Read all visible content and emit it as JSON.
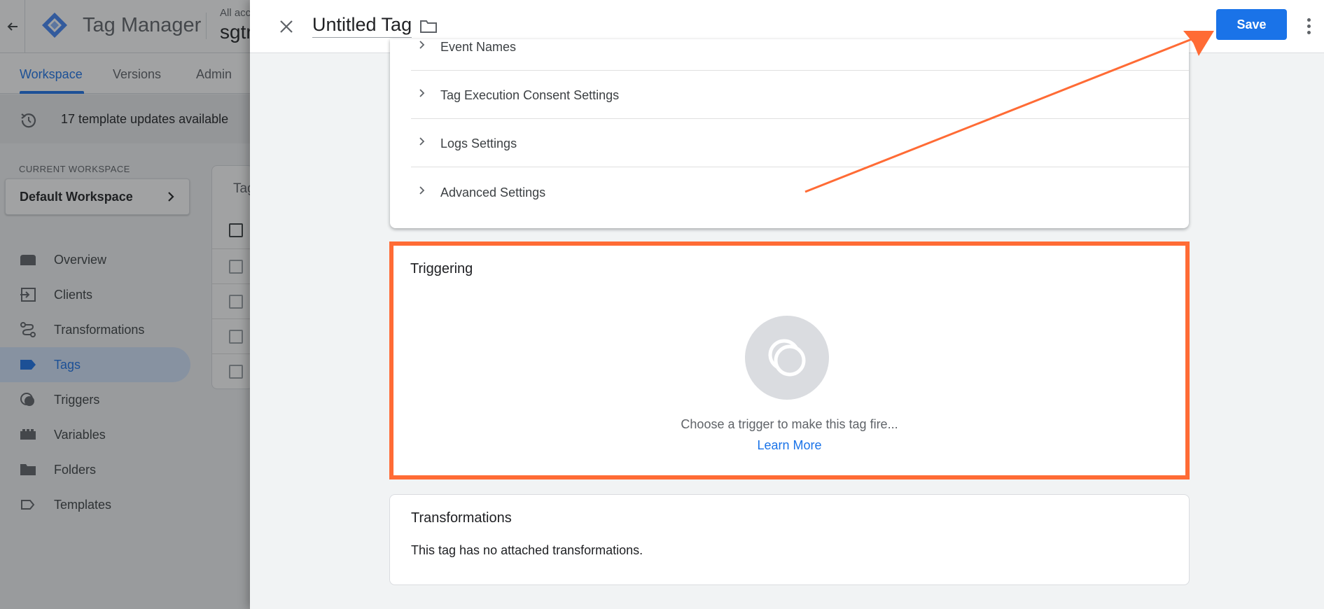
{
  "app": {
    "name": "Tag Manager",
    "account_small": "All acc",
    "account_big": "sgtr"
  },
  "nav_tabs": [
    {
      "label": "Workspace"
    },
    {
      "label": "Versions"
    },
    {
      "label": "Admin"
    }
  ],
  "updates": {
    "text": "17 template updates available"
  },
  "workspace": {
    "section_label": "CURRENT WORKSPACE",
    "name": "Default Workspace"
  },
  "sidebar": {
    "items": [
      {
        "label": "Overview",
        "icon": "overview-icon"
      },
      {
        "label": "Clients",
        "icon": "clients-icon"
      },
      {
        "label": "Transformations",
        "icon": "transformations-icon"
      },
      {
        "label": "Tags",
        "icon": "tag-icon",
        "active": true
      },
      {
        "label": "Triggers",
        "icon": "trigger-icon"
      },
      {
        "label": "Variables",
        "icon": "variables-icon"
      },
      {
        "label": "Folders",
        "icon": "folder-icon"
      },
      {
        "label": "Templates",
        "icon": "template-icon"
      }
    ]
  },
  "bg_card": {
    "title": "Tag"
  },
  "sheet": {
    "title": "Untitled Tag",
    "save_label": "Save",
    "settings_rows": [
      {
        "label": "Event Names"
      },
      {
        "label": "Tag Execution Consent Settings"
      },
      {
        "label": "Logs Settings"
      },
      {
        "label": "Advanced Settings"
      }
    ],
    "triggering": {
      "title": "Triggering",
      "empty_text": "Choose a trigger to make this tag fire...",
      "learn_more": "Learn More"
    },
    "transformations": {
      "title": "Transformations",
      "empty_text": "This tag has no attached transformations."
    }
  },
  "colors": {
    "accent": "#1a73e8",
    "highlight": "#ff6b35",
    "active_nav_bg": "#d2e3fc"
  }
}
